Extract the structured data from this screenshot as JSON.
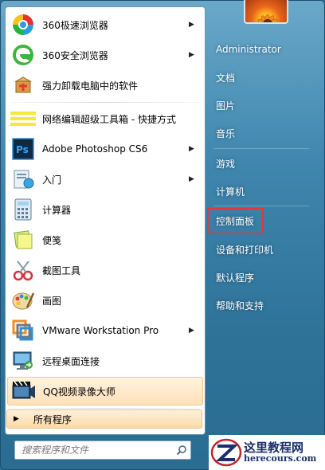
{
  "left": {
    "items": [
      {
        "label": "360极速浏览器",
        "icon": "360-speed-browser-icon",
        "has_submenu": true
      },
      {
        "label": "360安全浏览器",
        "icon": "360-safe-browser-icon",
        "has_submenu": true
      },
      {
        "label": "强力卸载电脑中的软件",
        "icon": "uninstaller-icon",
        "has_submenu": false
      },
      {
        "label": "网络编辑超级工具箱 - 快捷方式",
        "icon": "toolbox-icon",
        "has_submenu": false
      },
      {
        "label": "Adobe Photoshop CS6",
        "icon": "photoshop-icon",
        "has_submenu": true
      },
      {
        "label": "入门",
        "icon": "getting-started-icon",
        "has_submenu": true
      },
      {
        "label": "计算器",
        "icon": "calculator-icon",
        "has_submenu": false
      },
      {
        "label": "便笺",
        "icon": "sticky-notes-icon",
        "has_submenu": false
      },
      {
        "label": "截图工具",
        "icon": "snipping-tool-icon",
        "has_submenu": false
      },
      {
        "label": "画图",
        "icon": "paint-icon",
        "has_submenu": false
      },
      {
        "label": "VMware Workstation Pro",
        "icon": "vmware-icon",
        "has_submenu": true
      },
      {
        "label": "远程桌面连接",
        "icon": "remote-desktop-icon",
        "has_submenu": false
      },
      {
        "label": "QQ视频录像大师",
        "icon": "qq-video-recorder-icon",
        "has_submenu": false
      }
    ],
    "all_programs": "所有程序",
    "search_placeholder": "搜索程序和文件"
  },
  "right": {
    "items": [
      {
        "label": "Administrator"
      },
      {
        "label": "文档"
      },
      {
        "label": "图片"
      },
      {
        "label": "音乐"
      },
      {
        "label": "游戏"
      },
      {
        "label": "计算机"
      },
      {
        "label": "控制面板"
      },
      {
        "label": "设备和打印机"
      },
      {
        "label": "默认程序"
      },
      {
        "label": "帮助和支持"
      }
    ]
  },
  "watermark": {
    "title": "这里教程网",
    "url": "herecours.com"
  },
  "colors": {
    "frame_blue": "#3f86ad",
    "highlight_red": "#e5363a",
    "hover_orange": "#fde1b8"
  }
}
